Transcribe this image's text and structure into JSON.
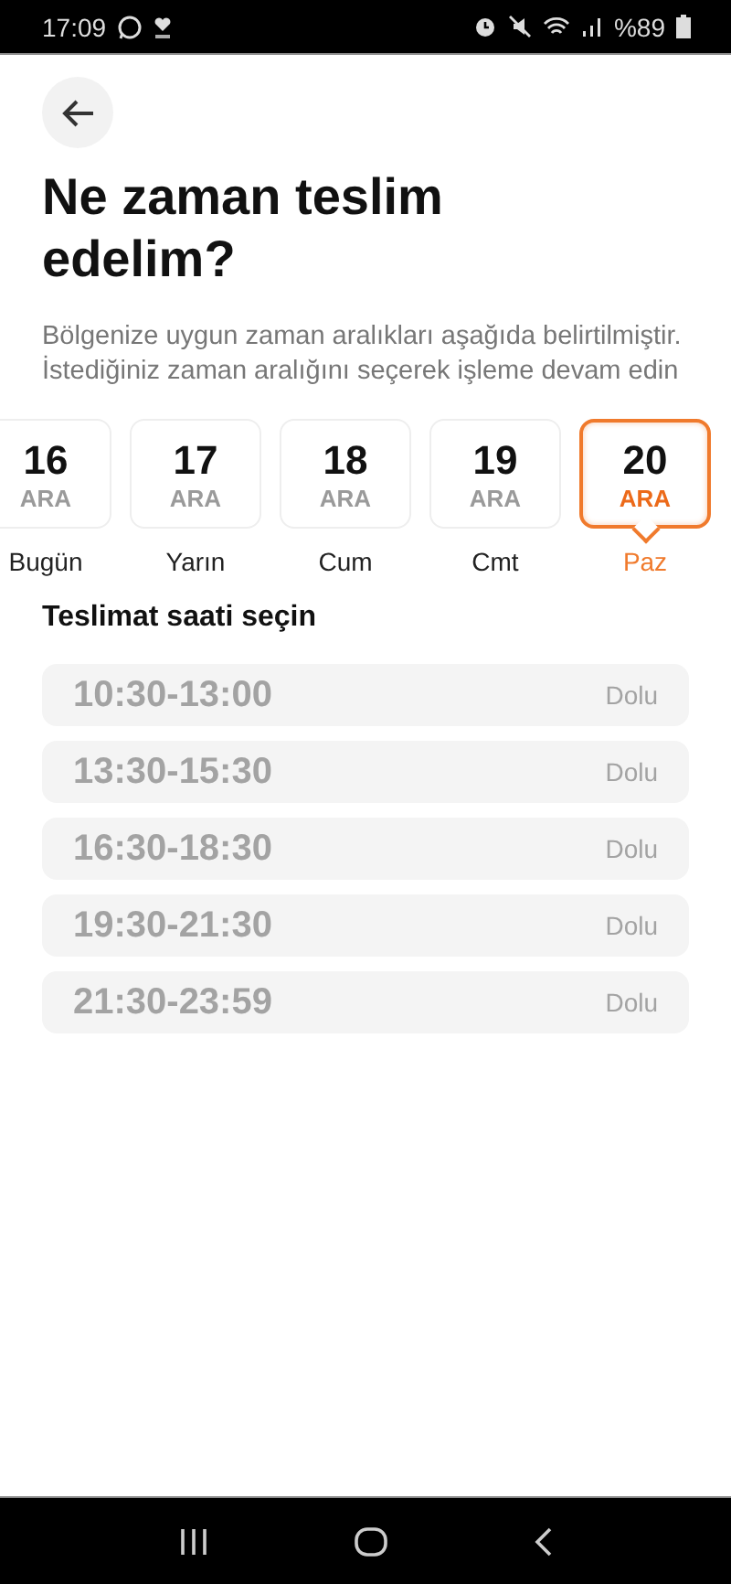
{
  "status_bar": {
    "time": "17:09",
    "battery": "%89"
  },
  "title": "Ne zaman teslim edelim?",
  "subtitle": "Bölgenize uygun zaman aralıkları aşağıda belirtilmiştir. İstediğiniz zaman aralığını seçerek işleme devam edin",
  "days": [
    {
      "number": "16",
      "month": "ARA",
      "weekday": "Bugün",
      "selected": false
    },
    {
      "number": "17",
      "month": "ARA",
      "weekday": "Yarın",
      "selected": false
    },
    {
      "number": "18",
      "month": "ARA",
      "weekday": "Cum",
      "selected": false
    },
    {
      "number": "19",
      "month": "ARA",
      "weekday": "Cmt",
      "selected": false
    },
    {
      "number": "20",
      "month": "ARA",
      "weekday": "Paz",
      "selected": true
    }
  ],
  "slots_heading": "Teslimat saati seçin",
  "slots": [
    {
      "time": "10:30-13:00",
      "status": "Dolu",
      "disabled": true
    },
    {
      "time": "13:30-15:30",
      "status": "Dolu",
      "disabled": true
    },
    {
      "time": "16:30-18:30",
      "status": "Dolu",
      "disabled": true
    },
    {
      "time": "19:30-21:30",
      "status": "Dolu",
      "disabled": true
    },
    {
      "time": "21:30-23:59",
      "status": "Dolu",
      "disabled": true
    }
  ]
}
